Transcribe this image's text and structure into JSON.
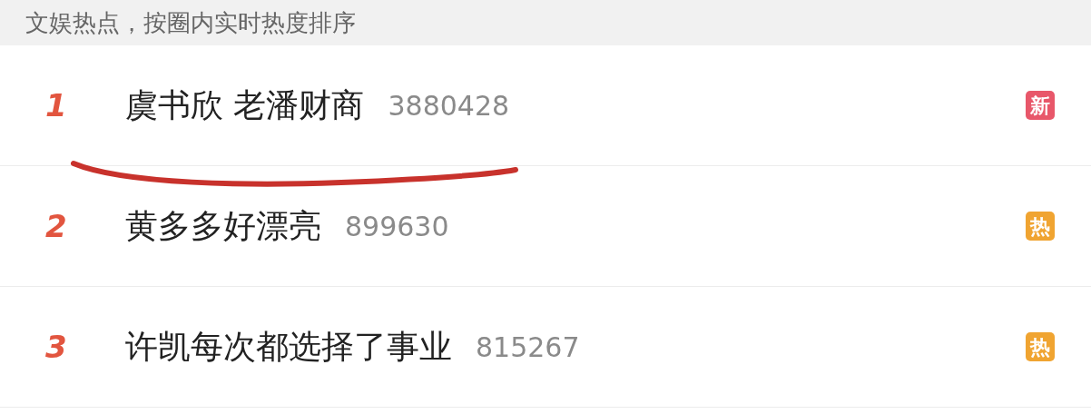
{
  "header": {
    "title": "文娱热点，按圈内实时热度排序"
  },
  "items": [
    {
      "rank": "1",
      "title": "虞书欣 老潘财商",
      "count": "3880428",
      "badge": {
        "text": "新",
        "color": "#e8576a"
      },
      "underlined": true
    },
    {
      "rank": "2",
      "title": "黄多多好漂亮",
      "count": "899630",
      "badge": {
        "text": "热",
        "color": "#f0a431"
      },
      "underlined": false
    },
    {
      "rank": "3",
      "title": "许凯每次都选择了事业",
      "count": "815267",
      "badge": {
        "text": "热",
        "color": "#f0a431"
      },
      "underlined": false
    }
  ]
}
